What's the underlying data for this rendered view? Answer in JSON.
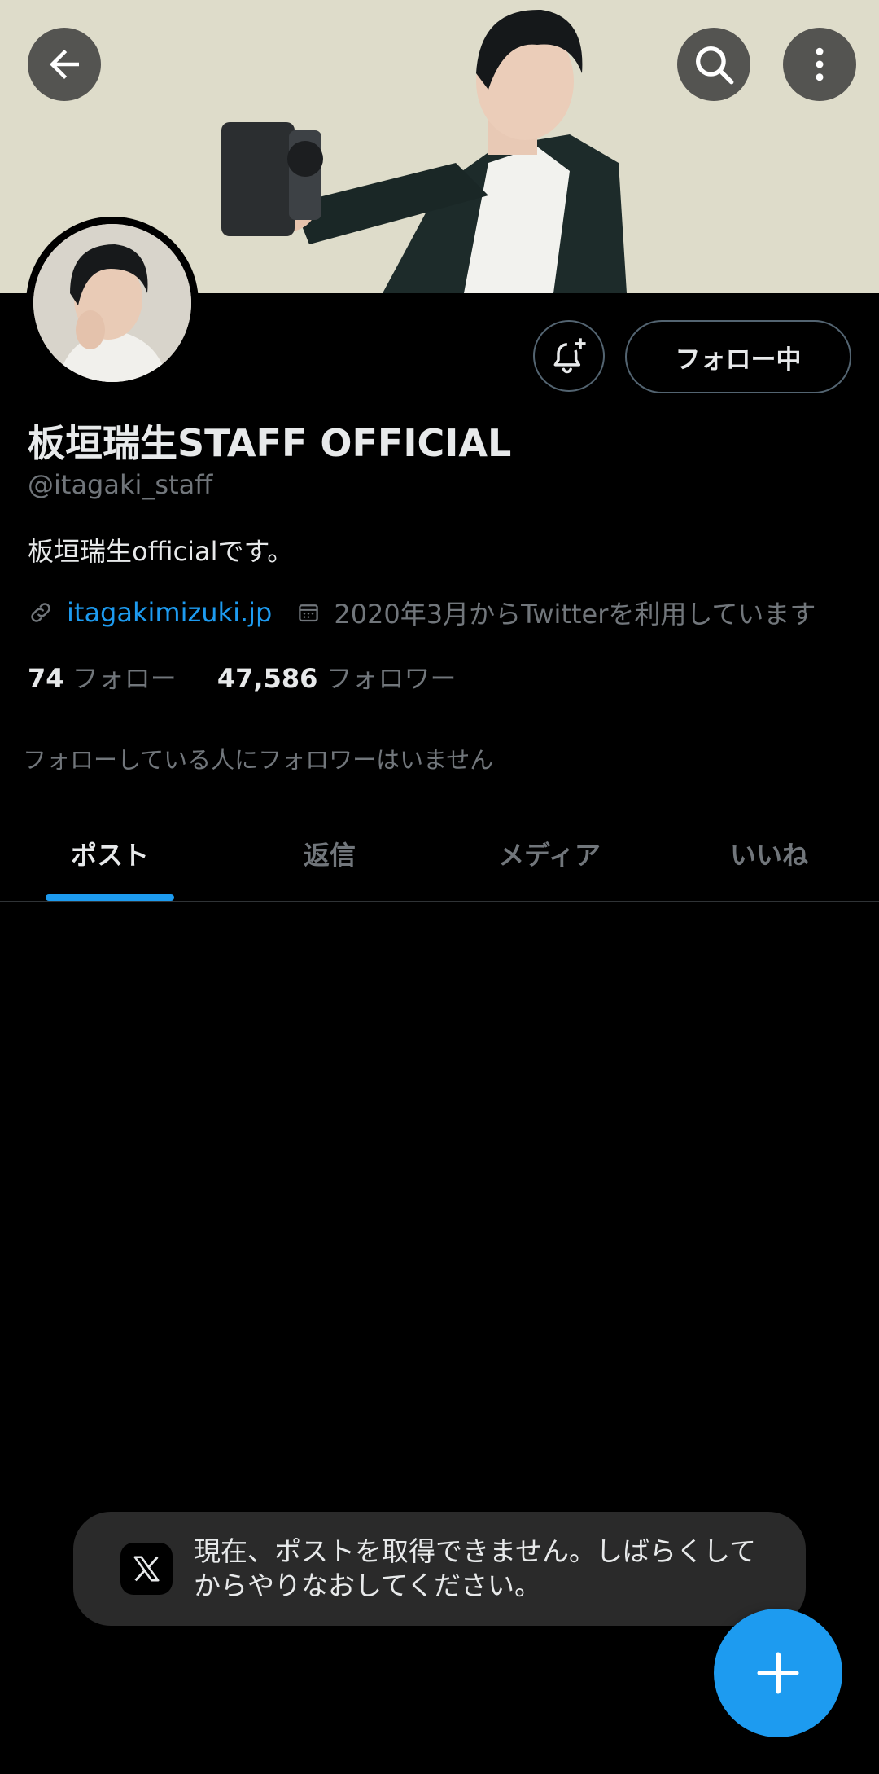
{
  "header": {
    "back_icon": "arrow-left-icon",
    "search_icon": "search-icon",
    "more_icon": "more-vertical-icon"
  },
  "profile": {
    "display_name": "板垣瑞生STAFF OFFICIAL",
    "handle": "@itagaki_staff",
    "bio": "板垣瑞生officialです。",
    "website": "itagakimizuki.jp",
    "joined": "2020年3月からTwitterを利用しています",
    "following_count": "74",
    "following_label": "フォロー",
    "followers_count": "47,586",
    "followers_label": "フォロワー",
    "followers_you_know": "フォローしている人にフォロワーはいません",
    "follow_button": "フォロー中"
  },
  "tabs": [
    {
      "label": "ポスト",
      "active": true
    },
    {
      "label": "返信",
      "active": false
    },
    {
      "label": "メディア",
      "active": false
    },
    {
      "label": "いいね",
      "active": false
    }
  ],
  "toast": {
    "message": "現在、ポストを取得できません。しばらくしてからやりなおしてください。"
  },
  "colors": {
    "accent": "#1d9bf0",
    "background": "#000000",
    "secondary_text": "#71767b"
  }
}
